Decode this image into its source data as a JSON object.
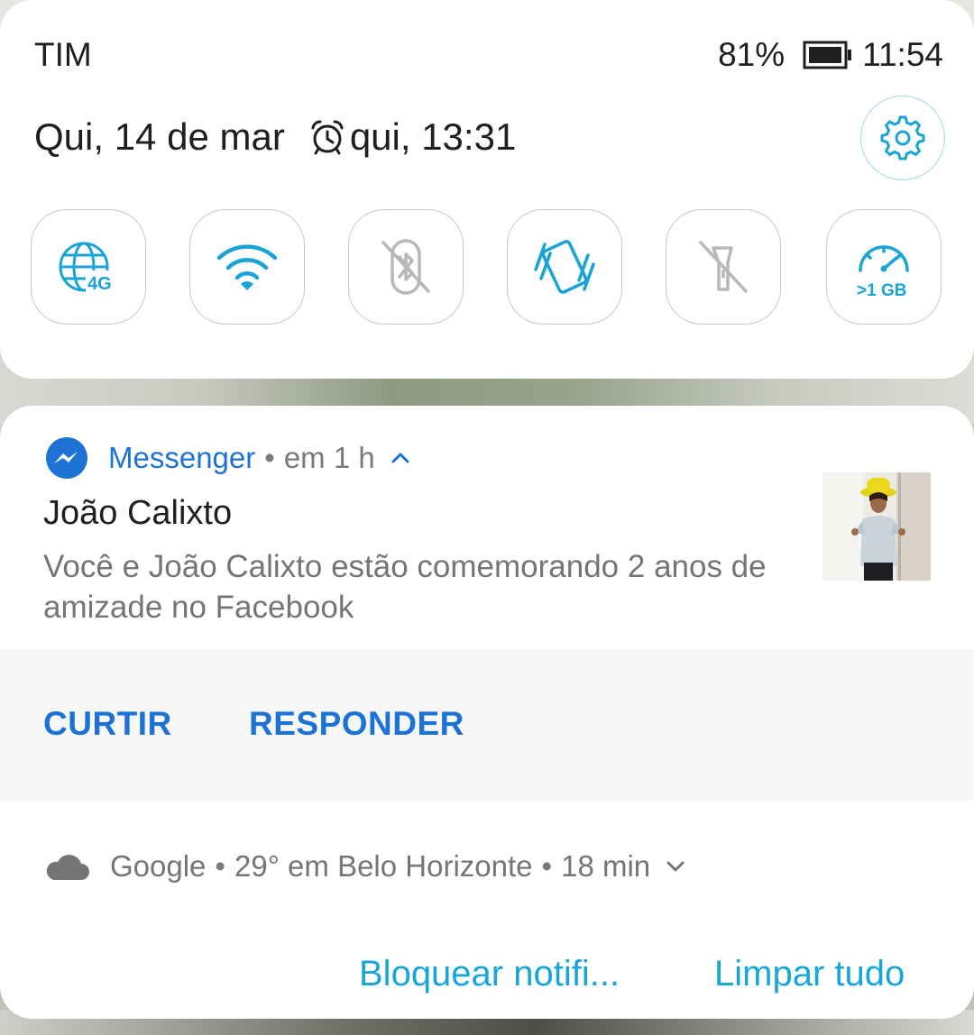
{
  "status_bar": {
    "carrier": "TIM",
    "battery_percent": "81%",
    "battery_level": 0.81,
    "time": "11:54"
  },
  "date_row": {
    "date": "Qui, 14 de mar",
    "alarm": "qui, 13:31"
  },
  "quick_tiles": [
    {
      "name": "mobile-data-4g",
      "icon": "globe-4g-icon",
      "label": "4G",
      "active": true
    },
    {
      "name": "wifi",
      "icon": "wifi-icon",
      "active": true
    },
    {
      "name": "bluetooth",
      "icon": "bluetooth-off-icon",
      "active": false
    },
    {
      "name": "vibrate",
      "icon": "vibrate-icon",
      "active": true
    },
    {
      "name": "flashlight",
      "icon": "flashlight-off-icon",
      "active": false
    },
    {
      "name": "data-usage",
      "icon": "speedometer-icon",
      "label": ">1 GB",
      "active": true
    }
  ],
  "notification": {
    "app": "Messenger",
    "separator": "•",
    "time_ago": "em 1 h",
    "title": "João Calixto",
    "body": "Você e João Calixto estão comemorando 2 anos de amizade no Facebook",
    "actions": {
      "like": "CURTIR",
      "reply": "RESPONDER"
    }
  },
  "google_notification": {
    "app": "Google",
    "separator": "•",
    "weather": "29° em Belo Horizonte",
    "time_ago": "18 min"
  },
  "footer": {
    "block": "Bloquear notifi...",
    "clear_all": "Limpar tudo"
  },
  "colors": {
    "accent_blue": "#1d72d6",
    "teal": "#17a6d9",
    "icon_active": "#1aa3d6",
    "icon_inactive": "#b8b8b8",
    "text_primary": "#1f1f1f",
    "text_secondary": "#757575"
  }
}
